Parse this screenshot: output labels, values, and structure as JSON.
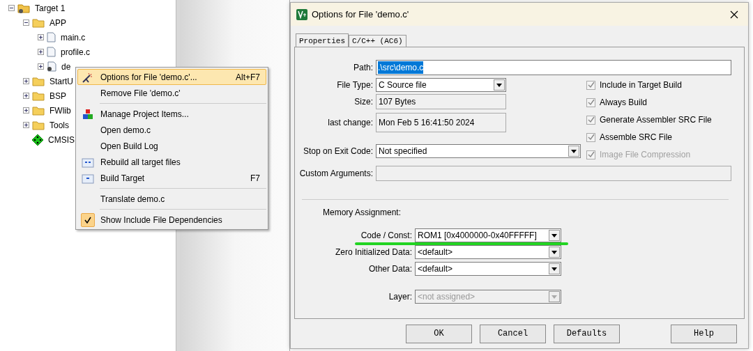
{
  "tree": [
    {
      "label": "Target 1",
      "kind": "target",
      "expanded": true,
      "children": [
        {
          "label": "APP",
          "kind": "folder",
          "expanded": true,
          "children": [
            {
              "label": "main.c",
              "kind": "file",
              "expanded": false
            },
            {
              "label": "profile.c",
              "kind": "file",
              "expanded": false
            },
            {
              "label": "de",
              "kind": "file-gear",
              "expanded": false
            }
          ]
        },
        {
          "label": "StartU",
          "kind": "folder",
          "expanded": false
        },
        {
          "label": "BSP",
          "kind": "folder",
          "expanded": false
        },
        {
          "label": "FWlib",
          "kind": "folder",
          "expanded": false
        },
        {
          "label": "Tools",
          "kind": "folder",
          "expanded": false
        },
        {
          "label": "CMSIS",
          "kind": "component"
        }
      ]
    }
  ],
  "context_menu": [
    {
      "kind": "options",
      "label": "Options for File 'demo.c'...",
      "shortcut": "Alt+F7",
      "selected": true
    },
    {
      "kind": "plain",
      "label": "Remove File 'demo.c'",
      "selected": false
    },
    {
      "kind": "separator"
    },
    {
      "kind": "manage",
      "label": "Manage Project Items...",
      "selected": false
    },
    {
      "kind": "plain",
      "label": "Open demo.c",
      "selected": false
    },
    {
      "kind": "plain",
      "label": "Open Build Log",
      "selected": false
    },
    {
      "kind": "rebuild",
      "label": "Rebuild all target files",
      "selected": false
    },
    {
      "kind": "build",
      "label": "Build Target",
      "shortcut": "F7",
      "selected": false
    },
    {
      "kind": "separator"
    },
    {
      "kind": "plain",
      "label": "Translate demo.c",
      "selected": false
    },
    {
      "kind": "separator"
    },
    {
      "kind": "toggle",
      "label": "Show Include File Dependencies",
      "selected": false,
      "checked": true
    }
  ],
  "dialog": {
    "title": "Options for File 'demo.c'",
    "tabs": [
      {
        "label": "Properties",
        "selected": true
      },
      {
        "label": "C/C++ (AC6)",
        "selected": false
      }
    ],
    "path": {
      "label": "Path:",
      "value": ".\\src\\demo.c",
      "highlighted": true
    },
    "file_type": {
      "label": "File Type:",
      "value": "C Source file"
    },
    "size": {
      "label": "Size:",
      "value": "107 Bytes"
    },
    "last_change": {
      "label": "last change:",
      "value": "Mon Feb  5 16:41:50 2024"
    },
    "stop_on_exit": {
      "label": "Stop on Exit Code:",
      "value": "Not specified"
    },
    "custom_arguments": {
      "label": "Custom Arguments:"
    },
    "options": [
      {
        "label": "Include in Target Build",
        "checked": true,
        "disabled": false
      },
      {
        "label": "Always Build",
        "checked": true,
        "disabled": false
      },
      {
        "label": "Generate Assembler SRC File",
        "checked": true,
        "disabled": false
      },
      {
        "label": "Assemble SRC File",
        "checked": true,
        "disabled": false
      },
      {
        "label": "Image File Compression",
        "checked": true,
        "disabled": true
      }
    ],
    "memory_title": "Memory Assignment:",
    "memory": [
      {
        "label": "Code / Const:",
        "value": "ROM1 [0x4000000-0x40FFFFF]",
        "disabled": false,
        "underlined": true
      },
      {
        "label": "Zero Initialized Data:",
        "value": "<default>",
        "disabled": false,
        "underlined": false
      },
      {
        "label": "Other Data:",
        "value": "<default>",
        "disabled": false,
        "underlined": false
      },
      {
        "label": "Layer:",
        "value": "<not assigned>",
        "disabled": true,
        "underlined": false
      }
    ],
    "buttons": [
      "OK",
      "Cancel",
      "Defaults",
      "Help"
    ]
  }
}
